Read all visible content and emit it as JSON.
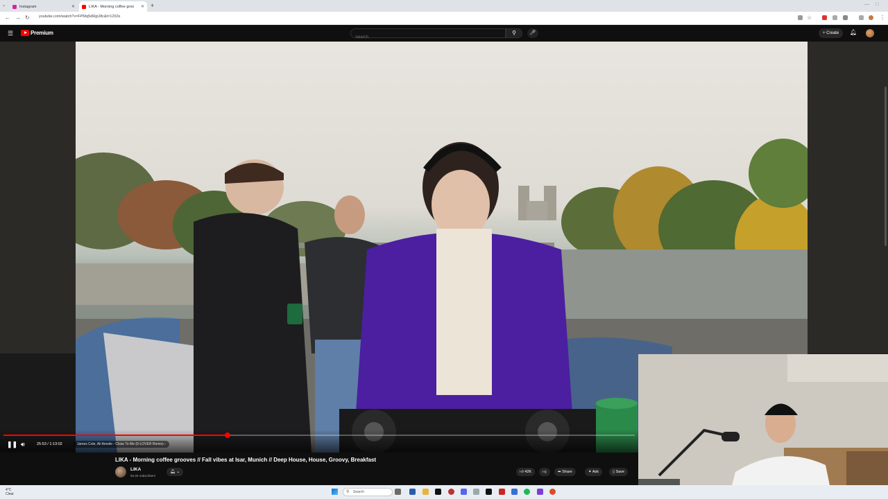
{
  "browser": {
    "tabs": [
      {
        "title": "Instagram",
        "favicon_color": "#d6249f",
        "active": false
      },
      {
        "title": "LIKA - Morning coffee groo",
        "favicon_color": "#ff0000",
        "active": true
      }
    ],
    "url": "youtube.com/watch?v=FPMq5dRgU8c&t=1202s"
  },
  "masthead": {
    "logo_text": "Premium",
    "search_placeholder": "Search",
    "create_label": "Create",
    "icons": [
      "menu-icon",
      "search-icon",
      "mic-icon",
      "bell-icon"
    ]
  },
  "player": {
    "current_time": "25:53 / 1:13:02",
    "chapter": "James Cole, Ali Amelie - Close To Me (0-LOVER Remix)  ›",
    "progress": 0.3545,
    "playing": true
  },
  "video_info": {
    "title": "LIKA - Morning coffee grooves // Fall vibes at Isar, Munich // Deep House, House, Groovy, Breakfast",
    "channel": "LIKA",
    "subscribers": "93.4K subscribers",
    "like_count": "42K",
    "share_label": "Share",
    "ask_label": "Ask",
    "save_label": "Save"
  },
  "taskbar": {
    "weather_temp": "4°C",
    "weather_desc": "Clear",
    "search_label": "Search"
  },
  "colors": {
    "youtube_red": "#ff0000",
    "masthead_bg": "#0f0f0f",
    "jacket_purple": "#4b1fa0"
  }
}
